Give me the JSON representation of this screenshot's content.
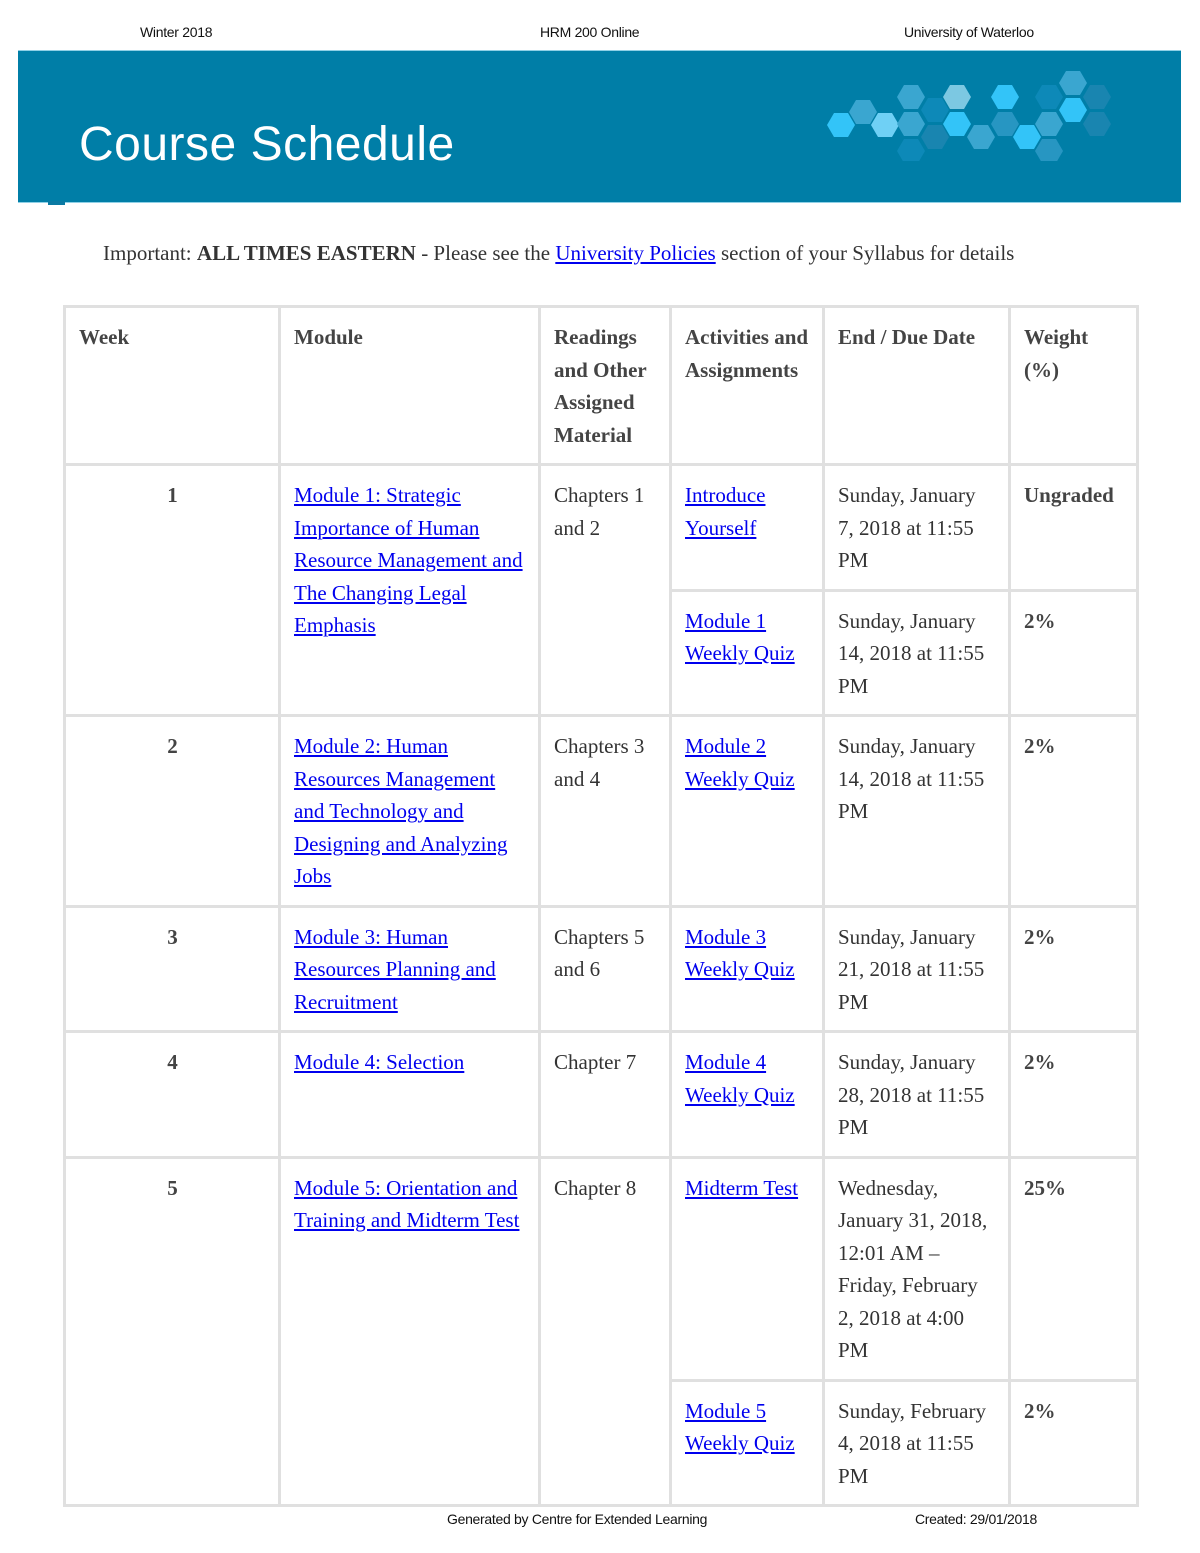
{
  "page_header": {
    "term": "Winter 2018",
    "course": "HRM 200 Online",
    "institution": "University of Waterloo"
  },
  "banner": {
    "title": "Course Schedule",
    "brand_color": "#007ea7",
    "decoration": "hexagon-pattern"
  },
  "notice": {
    "prefix": "Important: ",
    "emphasis": "ALL TIMES EASTERN",
    "middle": " - Please see the ",
    "link": "University Policies",
    "suffix": " section of your Syllabus for details"
  },
  "table": {
    "headers": {
      "week": "Week",
      "module": "Module",
      "readings": "Readings and Other Assigned Material",
      "activities": "Activities and Assignments",
      "due": "End / Due Date",
      "weight": "Weight (%)"
    },
    "rows": [
      {
        "week": "1",
        "module": "Module 1: Strategic Importance of Human Resource Management and The Changing Legal Emphasis",
        "readings": "Chapters 1 and 2",
        "activities": [
          {
            "name": "Introduce Yourself",
            "due": "Sunday, January 7, 2018 at 11:55 PM",
            "weight": "Ungraded"
          },
          {
            "name": "Module 1 Weekly Quiz",
            "due": "Sunday, January 14, 2018 at 11:55 PM",
            "weight": "2%"
          }
        ]
      },
      {
        "week": "2",
        "module": "Module 2: Human Resources Management and Technology and Designing and Analyzing Jobs",
        "readings": "Chapters 3 and 4",
        "activities": [
          {
            "name": "Module 2 Weekly Quiz",
            "due": "Sunday, January 14, 2018 at 11:55 PM",
            "weight": "2%"
          }
        ]
      },
      {
        "week": "3",
        "module": "Module 3: Human Resources Planning and Recruitment",
        "readings": "Chapters 5 and 6",
        "activities": [
          {
            "name": "Module 3 Weekly Quiz",
            "due": "Sunday, January 21, 2018 at 11:55 PM",
            "weight": "2%"
          }
        ]
      },
      {
        "week": "4",
        "module": "Module 4: Selection",
        "readings": "Chapter 7",
        "activities": [
          {
            "name": "Module 4 Weekly Quiz",
            "due": "Sunday, January 28, 2018 at 11:55 PM",
            "weight": "2%"
          }
        ]
      },
      {
        "week": "5",
        "module": "Module 5: Orientation and Training and Midterm Test",
        "readings": "Chapter 8",
        "activities": [
          {
            "name": "Midterm Test",
            "due": "Wednesday, January 31, 2018, 12:01 AM – Friday, February 2, 2018 at 4:00 PM",
            "weight": "25%"
          },
          {
            "name": "Module 5 Weekly Quiz",
            "due": "Sunday, February 4, 2018 at 11:55 PM",
            "weight": "2%"
          }
        ]
      }
    ]
  },
  "footer": {
    "generated_by": "Generated by Centre for Extended Learning",
    "created": "Created: 29/01/2018"
  }
}
